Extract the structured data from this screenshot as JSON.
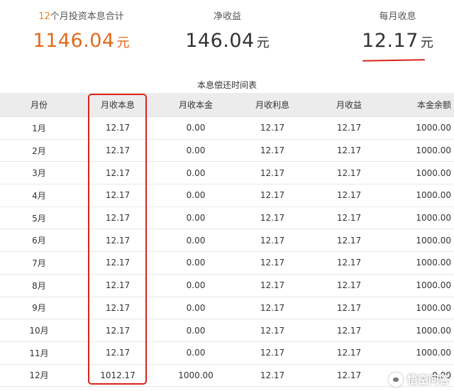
{
  "summary": {
    "total": {
      "label_highlight": "12",
      "label_rest": "个月投资本息合计",
      "value": "1146.04",
      "unit": "元"
    },
    "net_income": {
      "label": "净收益",
      "value": "146.04",
      "unit": "元"
    },
    "monthly": {
      "label": "每月收息",
      "value": "12.17",
      "unit": "元"
    }
  },
  "table": {
    "title": "本息偿还时间表",
    "headers": [
      "月份",
      "月收本息",
      "月收本金",
      "月收利息",
      "月收益",
      "本金余额"
    ],
    "rows": [
      [
        "1月",
        "12.17",
        "0.00",
        "12.17",
        "12.17",
        "1000.00"
      ],
      [
        "2月",
        "12.17",
        "0.00",
        "12.17",
        "12.17",
        "1000.00"
      ],
      [
        "3月",
        "12.17",
        "0.00",
        "12.17",
        "12.17",
        "1000.00"
      ],
      [
        "4月",
        "12.17",
        "0.00",
        "12.17",
        "12.17",
        "1000.00"
      ],
      [
        "5月",
        "12.17",
        "0.00",
        "12.17",
        "12.17",
        "1000.00"
      ],
      [
        "6月",
        "12.17",
        "0.00",
        "12.17",
        "12.17",
        "1000.00"
      ],
      [
        "7月",
        "12.17",
        "0.00",
        "12.17",
        "12.17",
        "1000.00"
      ],
      [
        "8月",
        "12.17",
        "0.00",
        "12.17",
        "12.17",
        "1000.00"
      ],
      [
        "9月",
        "12.17",
        "0.00",
        "12.17",
        "12.17",
        "1000.00"
      ],
      [
        "10月",
        "12.17",
        "0.00",
        "12.17",
        "12.17",
        "1000.00"
      ],
      [
        "11月",
        "12.17",
        "0.00",
        "12.17",
        "12.17",
        "1000.00"
      ],
      [
        "12月",
        "1012.17",
        "1000.00",
        "12.17",
        "12.17",
        "0.00"
      ]
    ]
  },
  "watermark": {
    "text": "悟空问答",
    "icon": "speech-bubble-icon"
  },
  "colors": {
    "accent_orange": "#e26a1b",
    "annotation_red": "#d9221c",
    "header_bg": "#ececec"
  }
}
